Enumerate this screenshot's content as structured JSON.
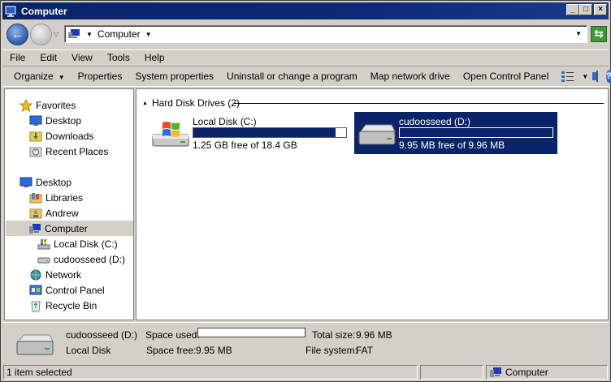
{
  "window": {
    "title": "Computer"
  },
  "address": {
    "location": "Computer"
  },
  "menu": [
    "File",
    "Edit",
    "View",
    "Tools",
    "Help"
  ],
  "toolbar": {
    "organize": "Organize",
    "properties": "Properties",
    "system_properties": "System properties",
    "uninstall": "Uninstall or change a program",
    "map_drive": "Map network drive",
    "control_panel": "Open Control Panel"
  },
  "nav": {
    "favorites": "Favorites",
    "desktop_fav": "Desktop",
    "downloads": "Downloads",
    "recent": "Recent Places",
    "desktop": "Desktop",
    "libraries": "Libraries",
    "andrew": "Andrew",
    "computer": "Computer",
    "local_disk": "Local Disk (C:)",
    "cudoosseed": "cudoosseed (D:)",
    "network": "Network",
    "control_panel": "Control Panel",
    "recycle": "Recycle Bin"
  },
  "group": {
    "header": "Hard Disk Drives (2)"
  },
  "drives": [
    {
      "name": "Local Disk (C:)",
      "free_text": "1.25 GB free of 18.4 GB",
      "used_fraction": 0.93
    },
    {
      "name": "cudoosseed (D:)",
      "free_text": "9.95 MB free of 9.96 MB",
      "used_fraction": 0.0
    }
  ],
  "details": {
    "name": "cudoosseed (D:)",
    "type": "Local Disk",
    "space_used_label": "Space used:",
    "space_used_fraction": 0.0,
    "space_free_label": "Space free:",
    "space_free": "9.95 MB",
    "total_size_label": "Total size:",
    "total_size": "9.96 MB",
    "file_system_label": "File system:",
    "file_system": "FAT"
  },
  "status": {
    "left": "1 item selected",
    "right": "Computer"
  }
}
